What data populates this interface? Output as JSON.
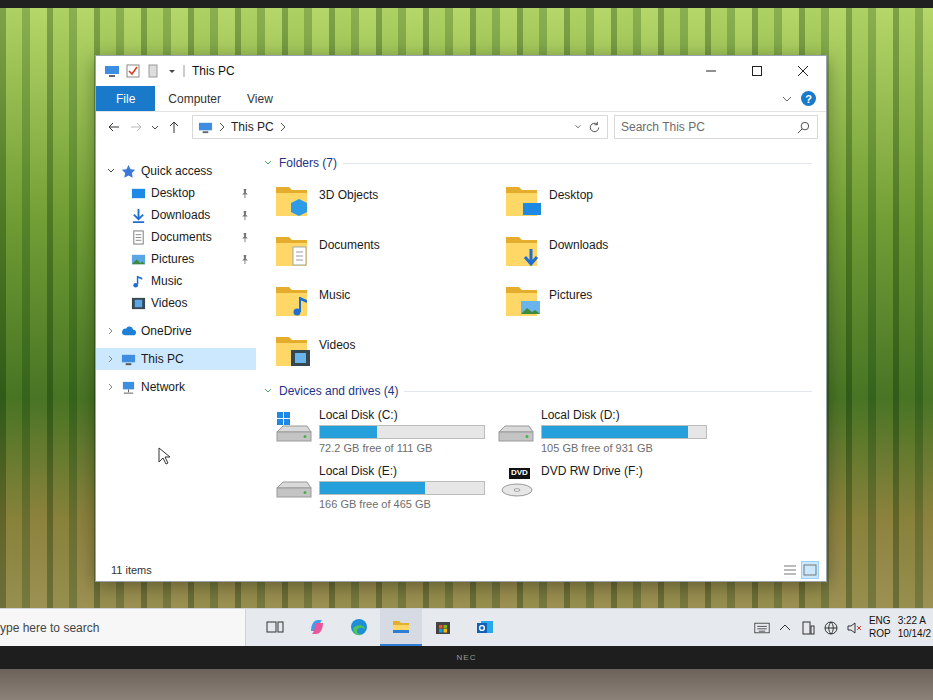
{
  "brand": "NEC",
  "window": {
    "title": "This PC",
    "help": "?"
  },
  "ribbon_tabs": [
    {
      "label": "File",
      "selected": true
    },
    {
      "label": "Computer",
      "selected": false
    },
    {
      "label": "View",
      "selected": false
    }
  ],
  "address": {
    "crumbs": [
      "This PC"
    ]
  },
  "search": {
    "placeholder": "Search This PC"
  },
  "nav": [
    {
      "label": "Quick access",
      "expanded": true,
      "selected": false,
      "children": [
        {
          "label": "Desktop",
          "pinned": true,
          "selected": false
        },
        {
          "label": "Downloads",
          "pinned": true,
          "selected": false
        },
        {
          "label": "Documents",
          "pinned": true,
          "selected": false
        },
        {
          "label": "Pictures",
          "pinned": true,
          "selected": false
        },
        {
          "label": "Music",
          "pinned": false,
          "selected": false
        },
        {
          "label": "Videos",
          "pinned": false,
          "selected": false
        }
      ]
    },
    {
      "label": "OneDrive",
      "expanded": false,
      "selected": false,
      "children": []
    },
    {
      "label": "This PC",
      "expanded": false,
      "selected": true,
      "children": []
    },
    {
      "label": "Network",
      "expanded": false,
      "selected": false,
      "children": []
    }
  ],
  "folders": {
    "title": "Folders (7)",
    "expanded": true,
    "items": [
      {
        "label": "3D Objects"
      },
      {
        "label": "Desktop"
      },
      {
        "label": "Documents"
      },
      {
        "label": "Downloads"
      },
      {
        "label": "Music"
      },
      {
        "label": "Pictures"
      },
      {
        "label": "Videos"
      }
    ]
  },
  "drives": {
    "title": "Devices and drives (4)",
    "expanded": true,
    "items": [
      {
        "label": "Local Disk (C:)",
        "kind": "system-disk",
        "level": 0.35,
        "free": "72.2 GB free of 111 GB"
      },
      {
        "label": "Local Disk (D:)",
        "kind": "disk",
        "level": 0.89,
        "free": "105 GB free of 931 GB"
      },
      {
        "label": "Local Disk (E:)",
        "kind": "disk",
        "level": 0.64,
        "free": "166 GB free of 465 GB"
      },
      {
        "label": "DVD RW Drive (F:)",
        "kind": "optical",
        "badge": "DVD"
      }
    ]
  },
  "status_bar": {
    "count": "11 items",
    "view_modes": [
      {
        "selected": false
      },
      {
        "selected": true
      }
    ]
  },
  "taskbar": {
    "search": "ype here to search",
    "apps": [
      {
        "selected": false
      },
      {
        "selected": false
      },
      {
        "selected": false
      },
      {
        "selected": true
      },
      {
        "selected": false
      },
      {
        "selected": false
      }
    ],
    "tray": {
      "lang": "ENG",
      "layout": "ROP",
      "time": "3:22 A",
      "date": "10/14/2"
    }
  }
}
